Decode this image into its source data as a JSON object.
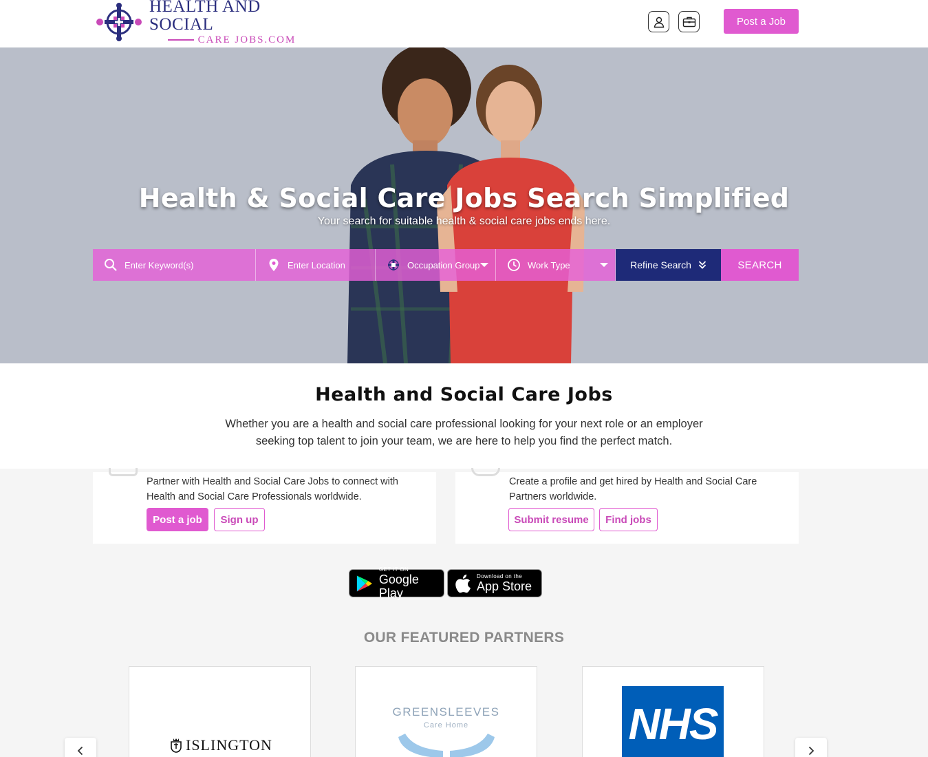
{
  "header": {
    "logo_line1": "HEALTH AND SOCIAL",
    "logo_line2": "CARE JOBS.COM",
    "user_icon": "user-icon",
    "briefcase_icon": "briefcase-icon",
    "post_job_label": "Post a Job"
  },
  "hero": {
    "title": "Health & Social Care Jobs Search Simplified",
    "subtitle": "Your search for suitable health & social care jobs ends here.",
    "search": {
      "keyword_placeholder": "Enter Keyword(s)",
      "location_placeholder": "Enter Location",
      "occupation_label": "Occupation Group",
      "work_type_label": "Work Type",
      "refine_label": "Refine Search",
      "search_label": "SEARCH"
    }
  },
  "intro": {
    "heading": "Health and Social Care Jobs",
    "text": "Whether you are a health and social care professional looking for your next role or an employer seeking top talent to join your team, we are here to help you find the perfect match."
  },
  "employer_card": {
    "text": "Partner with Health and Social Care Jobs to connect with Health and Social Care Professionals worldwide.",
    "post_job": "Post a job",
    "sign_up": "Sign up"
  },
  "candidate_card": {
    "text": "Create a profile and get hired by Health and Social Care Partners worldwide.",
    "submit_resume": "Submit resume",
    "find_jobs": "Find jobs"
  },
  "app_badges": {
    "google_small": "GET IT ON",
    "google_big": "Google Play",
    "apple_small": "Download on the",
    "apple_big": "App Store"
  },
  "partners": {
    "title": "OUR FEATURED PARTNERS",
    "items": [
      {
        "name": "ISLINGTON"
      },
      {
        "name": "GREENSLEEVES",
        "sub": "Care Home"
      },
      {
        "name": "NHS"
      }
    ]
  },
  "colors": {
    "accent": "#e05ad0",
    "navy": "#1e2a78",
    "nhs_blue": "#005eb8"
  }
}
